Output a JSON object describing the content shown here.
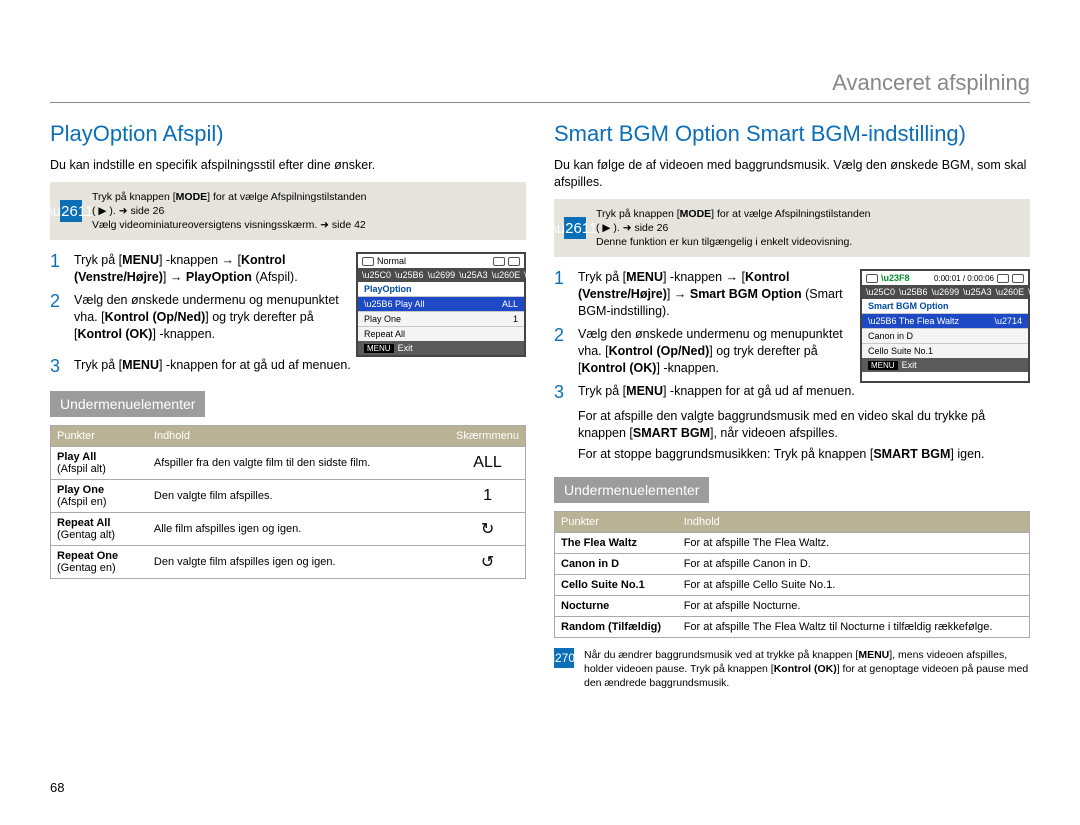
{
  "header": {
    "title": "Avanceret afspilning"
  },
  "page_number": "68",
  "left": {
    "title": "PlayOption Afspil)",
    "intro": "Du kan indstille en specifik afspilningsstil efter dine ønsker.",
    "infobox": {
      "line1_a": "Tryk på knappen [",
      "line1_b": "MODE",
      "line1_c": "] for at vælge Afspilningstilstanden",
      "line2": "( ▶ ). ➜ side 26",
      "line3": "Vælg videominiatureoversigtens visningsskærm. ➜ side 42"
    },
    "steps": [
      {
        "n": "1",
        "html": "Tryk på [<b>MENU</b>] -knappen <b>→</b> [<b>Kontrol (Venstre/Højre)</b>] <b>→</b> <b>PlayOption</b> (Afspil)."
      },
      {
        "n": "2",
        "html": "Vælg den ønskede undermenu og menupunktet vha. [<b>Kontrol (Op/Ned)</b>] og tryk derefter på [<b>Kontrol (OK)</b>] -knappen."
      },
      {
        "n": "3",
        "html": "Tryk på [<b>MENU</b>] -knappen for at gå ud af menuen."
      }
    ],
    "miniscreen": {
      "top_label": "Normal",
      "title": "PlayOption",
      "items": [
        {
          "label": "Play All",
          "tag": "ALL",
          "active": true
        },
        {
          "label": "Play One",
          "tag": "1",
          "active": false
        },
        {
          "label": "Repeat All",
          "tag": "",
          "active": false
        }
      ],
      "footer_label": "Exit",
      "footer_tag": "MENU"
    },
    "subhead": "Undermenuelementer",
    "table": {
      "headers": [
        "Punkter",
        "Indhold",
        "Skærmmenu"
      ],
      "rows": [
        {
          "punk_b": "Play All",
          "punk_s": "(Afspil alt)",
          "desc": "Afspiller fra den valgte film til den sidste film.",
          "sym": "ALL"
        },
        {
          "punk_b": "Play One",
          "punk_s": "(Afspil en)",
          "desc": "Den valgte film afspilles.",
          "sym": "1"
        },
        {
          "punk_b": "Repeat All",
          "punk_s": "(Gentag alt)",
          "desc": "Alle film afspilles igen og igen.",
          "sym": "↻"
        },
        {
          "punk_b": "Repeat One",
          "punk_s": "(Gentag en)",
          "desc": "Den valgte film afspilles igen og igen.",
          "sym": "↺"
        }
      ]
    }
  },
  "right": {
    "title": "Smart BGM Option Smart BGM-indstilling)",
    "intro": "Du kan følge de af videoen med baggrundsmusik. Vælg den ønskede BGM, som skal afspilles.",
    "infobox": {
      "line1_a": "Tryk på knappen [",
      "line1_b": "MODE",
      "line1_c": "] for at vælge Afspilningstilstanden",
      "line2": "( ▶ ). ➜ side 26",
      "line3": "Denne funktion er kun tilgængelig i enkelt videovisning."
    },
    "steps": [
      {
        "n": "1",
        "html": "Tryk på [<b>MENU</b>] -knappen <b>→</b> [<b>Kontrol (Venstre/Højre)</b>] <b>→</b> <b>Smart BGM Option</b> (Smart BGM-indstilling)."
      },
      {
        "n": "2",
        "html": "Vælg den ønskede undermenu og menupunktet vha. [<b>Kontrol (Op/Ned)</b>] og tryk derefter på [<b>Kontrol (OK)</b>] -knappen."
      },
      {
        "n": "3",
        "html": "Tryk på [<b>MENU</b>] -knappen for at gå ud af menuen."
      }
    ],
    "extras": [
      "For at afspille den valgte baggrundsmusik med en video skal du trykke på knappen [<b>SMART BGM</b>], når videoen afspilles.",
      "For at stoppe baggrundsmusikken: Tryk på knappen [<b>SMART BGM</b>] igen."
    ],
    "miniscreen": {
      "time": "0:00:01 / 0:00:06",
      "title": "Smart BGM Option",
      "items": [
        {
          "label": "The Flea Waltz",
          "active": true
        },
        {
          "label": "Canon in D",
          "active": false
        },
        {
          "label": "Cello Suite No.1",
          "active": false
        }
      ],
      "footer_label": "Exit",
      "footer_tag": "MENU"
    },
    "subhead": "Undermenuelementer",
    "table": {
      "headers": [
        "Punkter",
        "Indhold"
      ],
      "rows": [
        {
          "punk": "The Flea Waltz",
          "desc": "For at afspille The Flea Waltz."
        },
        {
          "punk": "Canon in D",
          "desc": "For at afspille Canon in D."
        },
        {
          "punk": "Cello Suite No.1",
          "desc": "For at afspille Cello Suite No.1."
        },
        {
          "punk": "Nocturne",
          "desc": "For at afspille Nocturne."
        },
        {
          "punk": "Random (Tilfældig)",
          "desc": "For at afspille The Flea Waltz til Nocturne i tilfældig rækkefølge."
        }
      ]
    },
    "footnote": "Når du ændrer baggrundsmusik ved at trykke på knappen [<b>MENU</b>], mens videoen afspilles, holder videoen pause. Tryk på knappen [<b>Kontrol (OK)</b>] for at genoptage videoen på pause med den ændrede baggrundsmusik."
  }
}
